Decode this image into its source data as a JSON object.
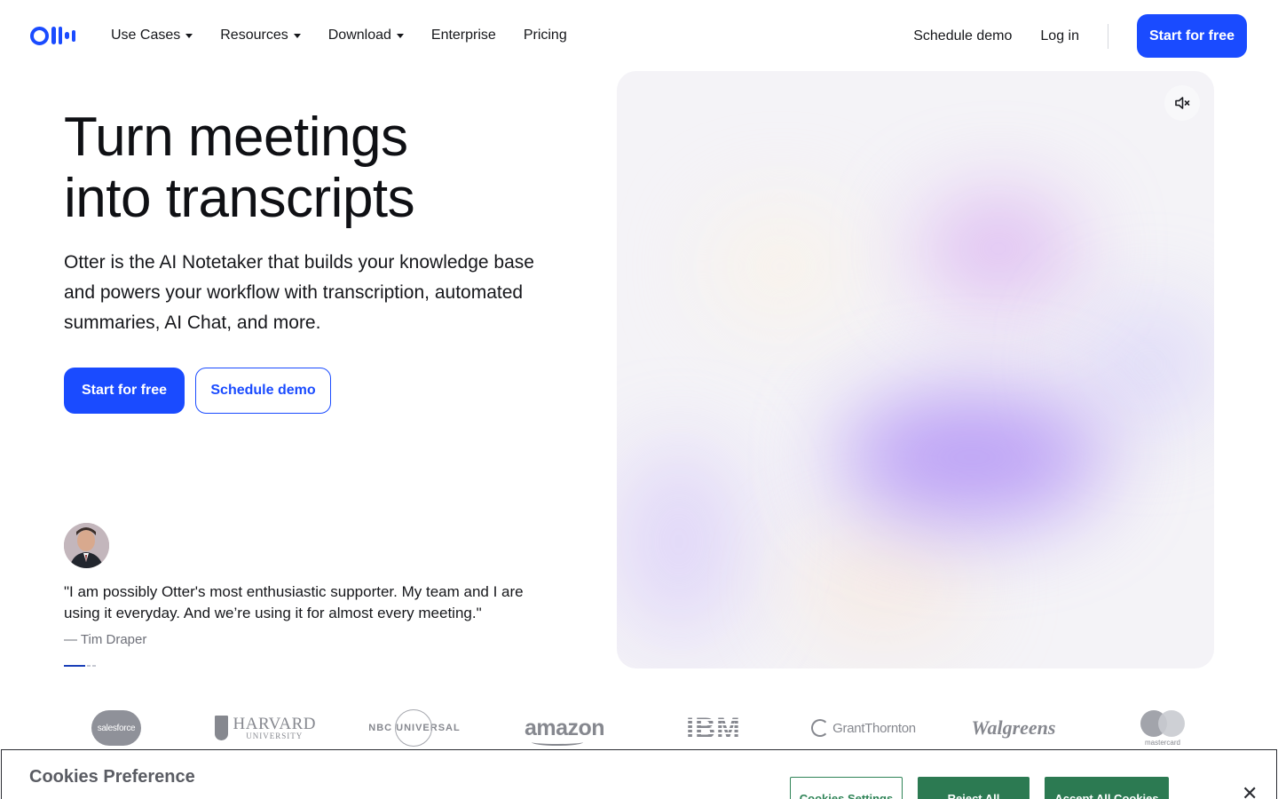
{
  "header": {
    "nav": [
      {
        "label": "Use Cases",
        "has_dropdown": true
      },
      {
        "label": "Resources",
        "has_dropdown": true
      },
      {
        "label": "Download",
        "has_dropdown": true
      },
      {
        "label": "Enterprise",
        "has_dropdown": false
      },
      {
        "label": "Pricing",
        "has_dropdown": false
      }
    ],
    "schedule_demo": "Schedule demo",
    "log_in": "Log in",
    "start_free": "Start for free"
  },
  "hero": {
    "title_line1": "Turn meetings",
    "title_line2": "into transcripts",
    "description": "Otter is the AI Notetaker that builds your knowledge base and powers your workflow with transcription, automated summaries, AI Chat, and more.",
    "cta_primary": "Start for free",
    "cta_secondary": "Schedule demo",
    "media_control_icon": "speaker-muted-icon"
  },
  "testimonial": {
    "quote": "\"I am possibly Otter's most enthusiastic supporter. My team and I are using it everyday. And we’re using it for almost every meeting.\"",
    "author": "— Tim Draper",
    "pages": 3,
    "active_page": 1
  },
  "logos": {
    "salesforce": "salesforce",
    "harvard_main": "HARVARD",
    "harvard_sub": "UNIVERSITY",
    "nbc": "NBC UNIVERSAL",
    "amazon": "amazon",
    "ibm": "IBM",
    "grant_thornton": "GrantThornton",
    "walgreens": "Walgreens",
    "mastercard": "mastercard"
  },
  "cookie": {
    "title": "Cookies Preference",
    "settings": "Cookies Settings",
    "reject": "Reject All",
    "accept": "Accept All Cookies",
    "close": "✕"
  },
  "colors": {
    "brand_blue": "#1a4bff",
    "cookie_green": "#2c7a52"
  }
}
